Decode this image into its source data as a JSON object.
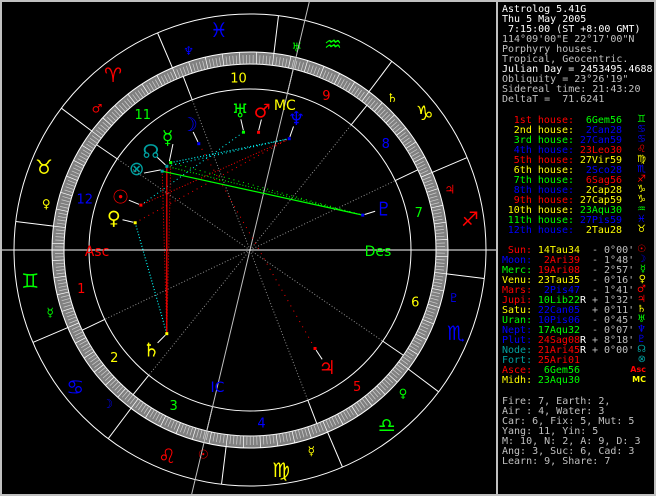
{
  "header": {
    "lines": [
      {
        "text": "Astrolog 5.41G",
        "color": "#ffffff"
      },
      {
        "text": "Thu 5 May 2005",
        "color": "#ffffff"
      },
      {
        "text": " 7:15:00 (ST +8:00 GMT)",
        "color": "#ffffff"
      },
      {
        "text": "114°09'00\"E 22°17'00\"N",
        "color": "#c0c0c0"
      },
      {
        "text": "Porphyry houses.",
        "color": "#c0c0c0"
      },
      {
        "text": "Tropical, Geocentric.",
        "color": "#c0c0c0"
      },
      {
        "text": "Julian Day = 2453495.4688",
        "color": "#ffffff"
      },
      {
        "text": "Obliquity = 23°26'19\"",
        "color": "#c0c0c0"
      },
      {
        "text": "Sidereal time: 21:43:20",
        "color": "#c0c0c0"
      },
      {
        "text": "DeltaT =  71.6241",
        "color": "#c0c0c0"
      }
    ]
  },
  "colors": {
    "fire": "#ff0000",
    "earth": "#ffff00",
    "air": "#00ff00",
    "water": "#0000ff",
    "node": "#00a0a0",
    "grey": "#c0c0c0",
    "white": "#ffffff"
  },
  "signs": [
    {
      "abbr": "Ari",
      "glyph": "♈",
      "ruler": "♂"
    },
    {
      "abbr": "Tau",
      "glyph": "♉",
      "ruler": "♀"
    },
    {
      "abbr": "Gem",
      "glyph": "♊",
      "ruler": "☿"
    },
    {
      "abbr": "Can",
      "glyph": "♋",
      "ruler": "☽"
    },
    {
      "abbr": "Leo",
      "glyph": "♌",
      "ruler": "☉"
    },
    {
      "abbr": "Vir",
      "glyph": "♍",
      "ruler": "☿"
    },
    {
      "abbr": "Lib",
      "glyph": "♎",
      "ruler": "♀"
    },
    {
      "abbr": "Sco",
      "glyph": "♏",
      "ruler": "♇"
    },
    {
      "abbr": "Sag",
      "glyph": "♐",
      "ruler": "♃"
    },
    {
      "abbr": "Cap",
      "glyph": "♑",
      "ruler": "♄"
    },
    {
      "abbr": "Aqu",
      "glyph": "♒",
      "ruler": "♅"
    },
    {
      "abbr": "Pis",
      "glyph": "♓",
      "ruler": "♆"
    }
  ],
  "houses": [
    {
      "label": "1st house:",
      "value": " 6Gem56"
    },
    {
      "label": "2nd house:",
      "value": " 2Can28"
    },
    {
      "label": "3rd house:",
      "value": "27Can59"
    },
    {
      "label": "4th house:",
      "value": "23Leo30"
    },
    {
      "label": "5th house:",
      "value": "27Vir59"
    },
    {
      "label": "6th house:",
      "value": " 2Sco28"
    },
    {
      "label": "7th house:",
      "value": " 6Sag56"
    },
    {
      "label": "8th house:",
      "value": " 2Cap28"
    },
    {
      "label": "9th house:",
      "value": "27Cap59"
    },
    {
      "label": "10th house:",
      "value": "23Aqu30"
    },
    {
      "label": "11th house:",
      "value": "27Pis59"
    },
    {
      "label": "12th house:",
      "value": " 2Tau28"
    }
  ],
  "house_numbers": [
    "1",
    "2",
    "3",
    "4",
    "5",
    "6",
    "7",
    "8",
    "9",
    "10",
    "11",
    "12"
  ],
  "planets": [
    {
      "label": "Sun:",
      "value": "14Tau34",
      "retro": " ",
      "speed": "- 0°00'",
      "glyph": "☉",
      "color": "#ff0000"
    },
    {
      "label": "Moon:",
      "value": " 2Ari39",
      "retro": " ",
      "speed": "- 1°48'",
      "glyph": "☽",
      "color": "#0000ff"
    },
    {
      "label": "Merc:",
      "value": "19Ari08",
      "retro": " ",
      "speed": "- 2°57'",
      "glyph": "☿",
      "color": "#00ff00"
    },
    {
      "label": "Venu:",
      "value": "23Tau35",
      "retro": " ",
      "speed": "- 0°16'",
      "glyph": "♀",
      "color": "#ffff00"
    },
    {
      "label": "Mars:",
      "value": " 2Pis47",
      "retro": " ",
      "speed": "- 1°41'",
      "glyph": "♂",
      "color": "#ff0000"
    },
    {
      "label": "Jupi:",
      "value": "10Lib22",
      "retro": "R",
      "speed": "+ 1°32'",
      "glyph": "♃",
      "color": "#ff0000"
    },
    {
      "label": "Satu:",
      "value": "22Can05",
      "retro": " ",
      "speed": "+ 0°11'",
      "glyph": "♄",
      "color": "#ffff00"
    },
    {
      "label": "Uran:",
      "value": "10Pis06",
      "retro": " ",
      "speed": "- 0°45'",
      "glyph": "♅",
      "color": "#00ff00"
    },
    {
      "label": "Nept:",
      "value": "17Aqu32",
      "retro": " ",
      "speed": "- 0°07'",
      "glyph": "♆",
      "color": "#0000ff"
    },
    {
      "label": "Plut:",
      "value": "24Sag08",
      "retro": "R",
      "speed": "+ 8°18'",
      "glyph": "♇",
      "color": "#0000ff"
    },
    {
      "label": "Node:",
      "value": "21Ari45",
      "retro": "R",
      "speed": "+ 0°00'",
      "glyph": "☊",
      "color": "#00a0a0"
    },
    {
      "label": "Fort:",
      "value": "25Ari01",
      "retro": " ",
      "speed": "",
      "glyph": "⊗",
      "color": "#00a0a0"
    },
    {
      "label": "Asce:",
      "value": " 6Gem56",
      "retro": " ",
      "speed": "",
      "glyph": "Asc",
      "color": "#ff0000"
    },
    {
      "label": "Midh:",
      "value": "23Aqu30",
      "retro": " ",
      "speed": "",
      "glyph": "MC",
      "color": "#ffff00"
    }
  ],
  "angles": {
    "asc": "Asc",
    "des": "Des",
    "mc": "MC",
    "ic": "IC"
  },
  "stats": [
    "Fire: 7, Earth: 2,",
    "Air : 4, Water: 3",
    "Car: 6, Fix: 5, Mut: 5",
    "Yang: 11, Yin: 5",
    "M: 10, N: 2, A: 9, D: 3",
    "Ang: 3, Suc: 6, Cad: 3",
    "Learn: 9, Share: 7"
  ]
}
